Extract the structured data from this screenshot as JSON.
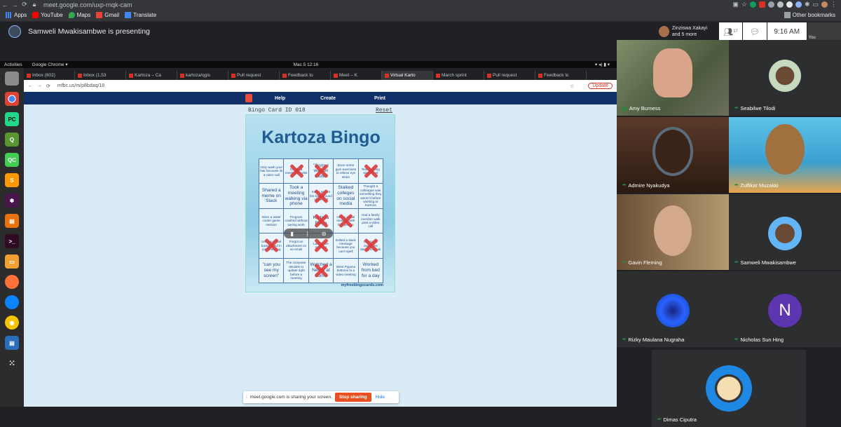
{
  "browser": {
    "url": "meet.google.com/uxp-rnqk-cam",
    "bookmarks": [
      "Apps",
      "YouTube",
      "Maps",
      "Gmail",
      "Translate"
    ],
    "other_bookmarks": "Other bookmarks"
  },
  "meet": {
    "presenting_text": "Samweli Mwakisambwe is presenting",
    "top_user": "Zinziswa Xakayi",
    "top_user_more": "and 5 more",
    "participants_count": "17",
    "time": "9:16 AM",
    "you_label": "You"
  },
  "ubuntu": {
    "activities": "Activities",
    "app": "Google Chrome ▾",
    "clock": "Mac 5  12:16"
  },
  "shared_tabs": [
    "Inbox (802)",
    "Inbox (1,53",
    "Kartoza – Ca",
    "kartoza/qgis",
    "Pull request",
    "Feedback to",
    "Meet – K",
    "Virtual Karto",
    "March sprint",
    "Pull request",
    "Feedback lo"
  ],
  "shared_url": "mfbc.us/m/p8bdaq/18",
  "update_label": "Update",
  "site_nav": [
    "Help",
    "Create",
    "Print"
  ],
  "card": {
    "id_label": "Bingo Card ID 018",
    "reset_label": "Reset",
    "title": "Kartoza Bingo",
    "footer": "myfreebingocards.com",
    "cells": [
      {
        "t": "Only wash your hair because its a video call",
        "x": false,
        "big": false
      },
      {
        "t": "Create a meeting playlist",
        "x": true,
        "big": false
      },
      {
        "t": "\"Sorry I was on mute\"",
        "x": true,
        "big": true
      },
      {
        "t": "Done some gym exercises to relieve eye strain",
        "x": false,
        "big": false
      },
      {
        "t": "Test meeting speed test",
        "x": true,
        "big": false
      },
      {
        "t": "Shared a meme on Slack",
        "x": false,
        "big": true
      },
      {
        "t": "Took a meeting walking via phone",
        "x": false,
        "big": true
      },
      {
        "t": "Kids / pets in the background of the call",
        "x": true,
        "big": false
      },
      {
        "t": "Stalked colleges on social media",
        "x": false,
        "big": true
      },
      {
        "t": "Thought a colleague was something they weren't before working at Kartoza",
        "x": false,
        "big": false
      },
      {
        "t": "Wore a water cooler game session",
        "x": false,
        "big": false
      },
      {
        "t": "Program crashed without saving work",
        "x": false,
        "big": false
      },
      {
        "t": "Kartoza Bingo",
        "x": true,
        "big": true
      },
      {
        "t": "Had a virtual meeting with this person",
        "x": true,
        "big": false
      },
      {
        "t": "Had a family member walk past a video call",
        "x": false,
        "big": false
      },
      {
        "t": "Used a virtual background in your meeting",
        "x": true,
        "big": false
      },
      {
        "t": "Forgot an attachment on an email",
        "x": false,
        "big": false
      },
      {
        "t": "Late to the meeting",
        "x": true,
        "big": false
      },
      {
        "t": "Edited a slack message because you can't spell",
        "x": false,
        "big": false
      },
      {
        "t": "Did some exercises during a break",
        "x": true,
        "big": false
      },
      {
        "t": "\"can you see my screen\"",
        "x": false,
        "big": true
      },
      {
        "t": "The computer decides to update right before a meeting",
        "x": false,
        "big": false
      },
      {
        "t": "Watched a Netflix at home",
        "x": true,
        "big": true
      },
      {
        "t": "Wore Pyjama bottoms to a video meeting",
        "x": false,
        "big": false
      },
      {
        "t": "Worked from bed for a day",
        "x": false,
        "big": true
      }
    ]
  },
  "share_bar": {
    "text": "meet.google.com is sharing your screen.",
    "stop": "Stop sharing",
    "hide": "Hide"
  },
  "participants": [
    {
      "name": "Amy Burness"
    },
    {
      "name": "Seabilwe Tilodi"
    },
    {
      "name": "Admire Nyakudya"
    },
    {
      "name": "Zulfikar Muzakki"
    },
    {
      "name": "Gavin Fleming"
    },
    {
      "name": "Samweli Mwakisambwe"
    },
    {
      "name": "Rizky Maulana Nugraha"
    },
    {
      "name": "Nicholas Sun Hing",
      "initial": "N"
    },
    {
      "name": "Dimas Ciputra"
    }
  ]
}
